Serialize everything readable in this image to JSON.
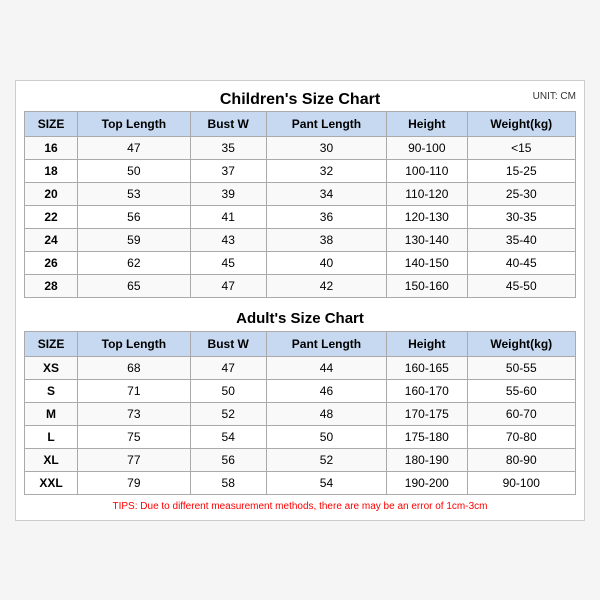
{
  "unit": "UNIT: CM",
  "children": {
    "title": "Children's Size Chart",
    "headers": [
      "SIZE",
      "Top Length",
      "Bust W",
      "Pant Length",
      "Height",
      "Weight(kg)"
    ],
    "rows": [
      [
        "16",
        "47",
        "35",
        "30",
        "90-100",
        "<15"
      ],
      [
        "18",
        "50",
        "37",
        "32",
        "100-110",
        "15-25"
      ],
      [
        "20",
        "53",
        "39",
        "34",
        "110-120",
        "25-30"
      ],
      [
        "22",
        "56",
        "41",
        "36",
        "120-130",
        "30-35"
      ],
      [
        "24",
        "59",
        "43",
        "38",
        "130-140",
        "35-40"
      ],
      [
        "26",
        "62",
        "45",
        "40",
        "140-150",
        "40-45"
      ],
      [
        "28",
        "65",
        "47",
        "42",
        "150-160",
        "45-50"
      ]
    ]
  },
  "adult": {
    "title": "Adult's Size Chart",
    "headers": [
      "SIZE",
      "Top Length",
      "Bust W",
      "Pant Length",
      "Height",
      "Weight(kg)"
    ],
    "rows": [
      [
        "XS",
        "68",
        "47",
        "44",
        "160-165",
        "50-55"
      ],
      [
        "S",
        "71",
        "50",
        "46",
        "160-170",
        "55-60"
      ],
      [
        "M",
        "73",
        "52",
        "48",
        "170-175",
        "60-70"
      ],
      [
        "L",
        "75",
        "54",
        "50",
        "175-180",
        "70-80"
      ],
      [
        "XL",
        "77",
        "56",
        "52",
        "180-190",
        "80-90"
      ],
      [
        "XXL",
        "79",
        "58",
        "54",
        "190-200",
        "90-100"
      ]
    ]
  },
  "tips": "TIPS: Due to different measurement methods, there are may be an error of 1cm-3cm"
}
